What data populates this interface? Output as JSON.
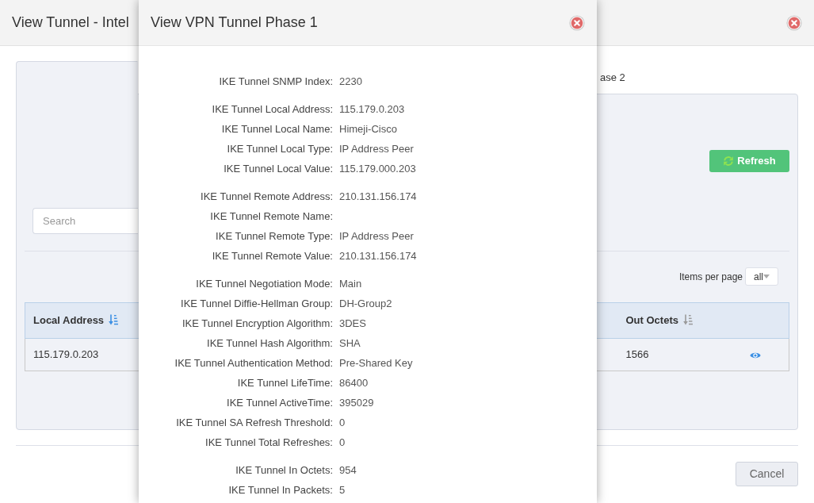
{
  "window": {
    "title": "View Tunnel - Intel"
  },
  "tabs": [
    {
      "selected": true
    },
    {
      "label": "ase 2",
      "selected": false
    }
  ],
  "toolbar": {
    "refresh_button": "Refresh",
    "search": {
      "placeholder": "Search"
    }
  },
  "pagination": {
    "label": "Items per page",
    "items_per_page": "all"
  },
  "table": {
    "columns": [
      {
        "label": "Local Address",
        "sorted": true
      },
      {
        "label": "Out Octets",
        "sorted": false
      }
    ],
    "rows": [
      {
        "cells": [
          "115.179.0.203",
          "1566"
        ]
      }
    ]
  },
  "footer": {
    "cancel_button": "Cancel"
  },
  "dialog": {
    "title": "View VPN Tunnel Phase 1",
    "groups": [
      {
        "fields": [
          {
            "label": "IKE Tunnel SNMP Index:",
            "value": "2230"
          }
        ]
      },
      {
        "fields": [
          {
            "label": "IKE Tunnel Local Address:",
            "value": "115.179.0.203"
          },
          {
            "label": "IKE Tunnel Local Name:",
            "value": "Himeji-Cisco"
          },
          {
            "label": "IKE Tunnel Local Type:",
            "value": "IP Address Peer"
          },
          {
            "label": "IKE Tunnel Local Value:",
            "value": "115.179.000.203"
          }
        ]
      },
      {
        "fields": [
          {
            "label": "IKE Tunnel Remote Address:",
            "value": "210.131.156.174"
          },
          {
            "label": "IKE Tunnel Remote Name:"
          },
          {
            "label": "IKE Tunnel Remote Type:",
            "value": "IP Address Peer"
          },
          {
            "label": "IKE Tunnel Remote Value:",
            "value": "210.131.156.174"
          }
        ]
      },
      {
        "fields": [
          {
            "label": "IKE Tunnel Negotiation Mode:",
            "value": "Main"
          },
          {
            "label": "IKE Tunnel Diffie-Hellman Group:",
            "value": "DH-Group2"
          },
          {
            "label": "IKE Tunnel Encryption Algorithm:",
            "value": "3DES"
          },
          {
            "label": "IKE Tunnel Hash Algorithm:",
            "value": "SHA"
          },
          {
            "label": "IKE Tunnel Authentication Method:",
            "value": "Pre-Shared Key"
          },
          {
            "label": "IKE Tunnel LifeTime:",
            "value": "86400"
          },
          {
            "label": "IKE Tunnel ActiveTime:",
            "value": "395029"
          },
          {
            "label": "IKE Tunnel SA Refresh Threshold:",
            "value": "0"
          },
          {
            "label": "IKE Tunnel Total Refreshes:",
            "value": "0"
          }
        ]
      },
      {
        "fields": [
          {
            "label": "IKE Tunnel In Octets:",
            "value": "954"
          },
          {
            "label": "IKE Tunnel In Packets:",
            "value": "5"
          }
        ]
      }
    ]
  }
}
